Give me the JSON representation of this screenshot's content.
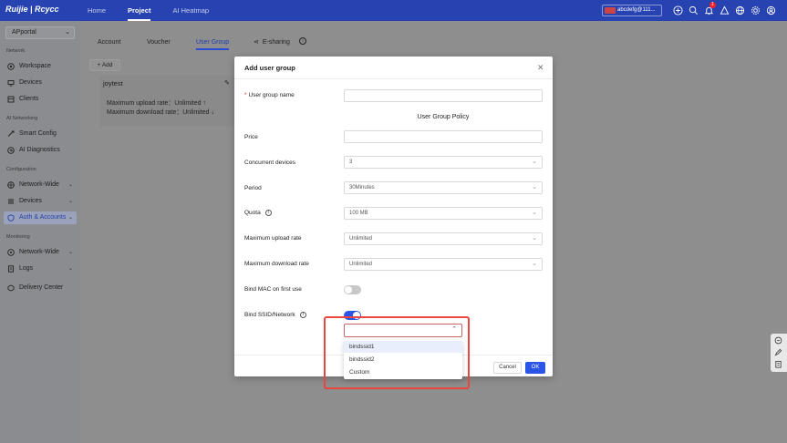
{
  "topbar": {
    "logo": "Ruijie | Rcycc",
    "nav": [
      "Home",
      "Project",
      "AI Heatmap"
    ],
    "active_nav": "Project",
    "account": "abcdefg@111...",
    "notification_count": "1"
  },
  "sidebar": {
    "site": "APportal",
    "sections": {
      "network": "Network",
      "ai_networking": "AI Networking",
      "configuration": "Configuration",
      "monitoring": "Monitoring"
    },
    "items": {
      "workspace": "Workspace",
      "devices": "Devices",
      "clients": "Clients",
      "smart_config": "Smart Config",
      "ai_diagnostics": "AI Diagnostics",
      "network_wide": "Network-Wide",
      "devices_config": "Devices",
      "auth_accounts": "Auth & Accounts",
      "network_wide_mon": "Network-Wide",
      "logs": "Logs",
      "delivery_center": "Delivery Center"
    }
  },
  "main": {
    "tabs": [
      "Account",
      "Voucher",
      "User Group",
      "E-sharing"
    ],
    "active_tab": "User Group",
    "add_label": "+ Add",
    "group": {
      "name": "joytest",
      "upload": "Maximum upload rate：Unlimited ↑",
      "download": "Maximum download rate：Unlimited ↓"
    }
  },
  "modal": {
    "title": "Add user group",
    "user_group_name_label": "User group name",
    "user_group_name_value": "",
    "policy_title": "User Group Policy",
    "price_label": "Price",
    "price_value": "",
    "concurrent_label": "Concurrent devices",
    "concurrent_value": "3",
    "period_label": "Period",
    "period_value": "30Minutes",
    "quota_label": "Quota",
    "quota_value": "100 MB",
    "upload_label": "Maximum upload rate",
    "upload_value": "Unlimited",
    "download_label": "Maximum download rate",
    "download_value": "Unlimited",
    "bind_mac_label": "Bind MAC on first use",
    "bind_mac_on": false,
    "bind_ssid_label": "Bind SSID/Network",
    "bind_ssid_on": true,
    "ssid_value": "",
    "ssid_options": [
      "bindssid1",
      "bindssid2",
      "Custom"
    ],
    "cancel_label": "Cancel",
    "ok_label": "OK"
  },
  "colors": {
    "topbar": "#2743b2",
    "primary": "#2b55e6",
    "highlight": "#e8463f"
  }
}
